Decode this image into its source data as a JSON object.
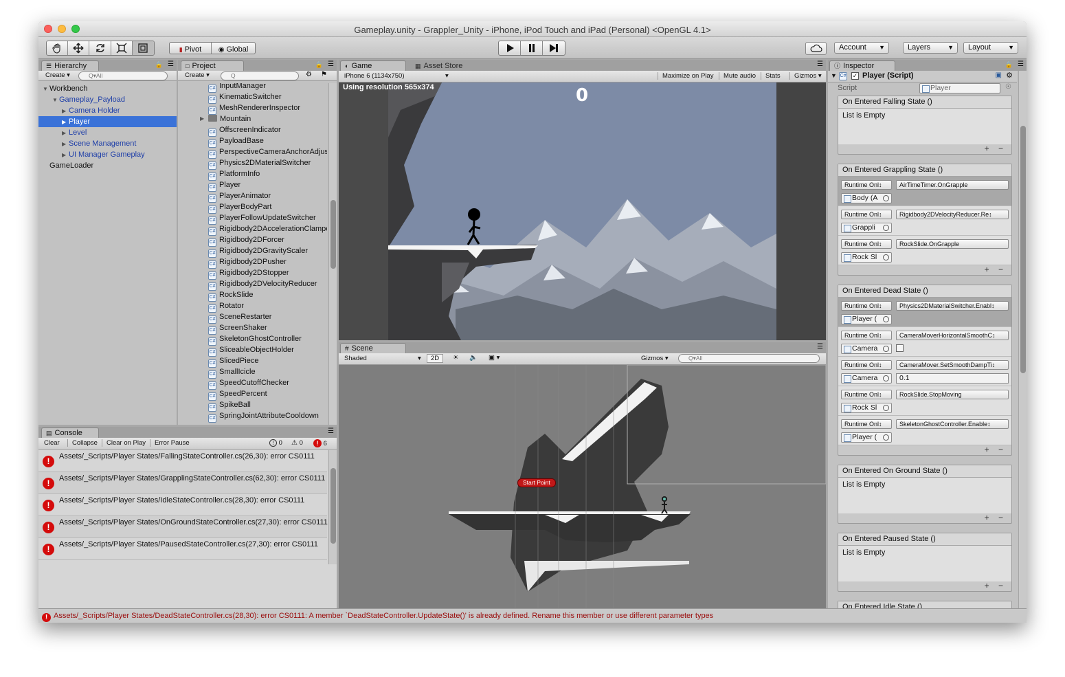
{
  "window": {
    "title": "Gameplay.unity - Grappler_Unity - iPhone, iPod Touch and iPad (Personal) <OpenGL 4.1>"
  },
  "toolbar": {
    "tools": [
      "hand-icon",
      "move-icon",
      "rotate-icon",
      "scale-icon",
      "rect-icon"
    ],
    "pivot_label": "Pivot",
    "global_label": "Global",
    "account_label": "Account",
    "layers_label": "Layers",
    "layout_label": "Layout"
  },
  "hierarchy": {
    "tab": "Hierarchy",
    "create_label": "Create",
    "search_placeholder": "Q▾All",
    "items": [
      {
        "label": "Workbench",
        "indent": 0,
        "expanded": true,
        "blue": false
      },
      {
        "label": "Gameplay_Payload",
        "indent": 1,
        "expanded": true,
        "blue": true
      },
      {
        "label": "Camera Holder",
        "indent": 2,
        "expanded": false,
        "blue": true
      },
      {
        "label": "Player",
        "indent": 2,
        "expanded": false,
        "blue": true,
        "selected": true
      },
      {
        "label": "Level",
        "indent": 2,
        "expanded": false,
        "blue": true
      },
      {
        "label": "Scene Management",
        "indent": 2,
        "expanded": false,
        "blue": true
      },
      {
        "label": "UI Manager Gameplay",
        "indent": 2,
        "expanded": false,
        "blue": true
      },
      {
        "label": "GameLoader",
        "indent": 0,
        "expanded": null,
        "blue": false
      }
    ]
  },
  "project": {
    "tab": "Project",
    "create_label": "Create",
    "search_placeholder": "Q",
    "items": [
      {
        "label": "InputManager",
        "type": "script"
      },
      {
        "label": "KinematicSwitcher",
        "type": "script"
      },
      {
        "label": "MeshRendererInspector",
        "type": "script"
      },
      {
        "label": "Mountain",
        "type": "folder"
      },
      {
        "label": "OffscreenIndicator",
        "type": "script"
      },
      {
        "label": "PayloadBase",
        "type": "script"
      },
      {
        "label": "PerspectiveCameraAnchorAdjuster",
        "type": "script"
      },
      {
        "label": "Physics2DMaterialSwitcher",
        "type": "script"
      },
      {
        "label": "PlatformInfo",
        "type": "script"
      },
      {
        "label": "Player",
        "type": "script"
      },
      {
        "label": "PlayerAnimator",
        "type": "script"
      },
      {
        "label": "PlayerBodyPart",
        "type": "script"
      },
      {
        "label": "PlayerFollowUpdateSwitcher",
        "type": "script"
      },
      {
        "label": "Rigidbody2DAccelerationClamper",
        "type": "script"
      },
      {
        "label": "Rigidbody2DForcer",
        "type": "script"
      },
      {
        "label": "Rigidbody2DGravityScaler",
        "type": "script"
      },
      {
        "label": "Rigidbody2DPusher",
        "type": "script"
      },
      {
        "label": "Rigidbody2DStopper",
        "type": "script"
      },
      {
        "label": "Rigidbody2DVelocityReducer",
        "type": "script"
      },
      {
        "label": "RockSlide",
        "type": "script"
      },
      {
        "label": "Rotator",
        "type": "script"
      },
      {
        "label": "SceneRestarter",
        "type": "script"
      },
      {
        "label": "ScreenShaker",
        "type": "script"
      },
      {
        "label": "SkeletonGhostController",
        "type": "script"
      },
      {
        "label": "SliceableObjectHolder",
        "type": "script"
      },
      {
        "label": "SlicedPiece",
        "type": "script"
      },
      {
        "label": "SmallIcicle",
        "type": "script"
      },
      {
        "label": "SpeedCutoffChecker",
        "type": "script"
      },
      {
        "label": "SpeedPercent",
        "type": "script"
      },
      {
        "label": "SpikeBall",
        "type": "script"
      },
      {
        "label": "SpringJointAttributeCooldown",
        "type": "script"
      }
    ]
  },
  "game": {
    "tab": "Game",
    "asset_store_tab": "Asset Store",
    "resolution_dropdown": "iPhone 6 (1134x750)",
    "maximize_label": "Maximize on Play",
    "mute_label": "Mute audio",
    "stats_label": "Stats",
    "gizmos_label": "Gizmos",
    "resolution_note": "Using resolution 565x374",
    "score": "0"
  },
  "scene": {
    "tab": "Scene",
    "shading": "Shaded",
    "mode_2d": "2D",
    "gizmos_label": "Gizmos",
    "search_placeholder": "Q▾All",
    "start_point_label": "Start Point"
  },
  "console": {
    "tab": "Console",
    "clear_label": "Clear",
    "collapse_label": "Collapse",
    "clear_on_play_label": "Clear on Play",
    "error_pause_label": "Error Pause",
    "info_count": "0",
    "warn_count": "0",
    "error_count": "6",
    "entries": [
      "Assets/_Scripts/Player States/FallingStateController.cs(26,30): error CS0111",
      "Assets/_Scripts/Player States/GrapplingStateController.cs(62,30): error CS0111",
      "Assets/_Scripts/Player States/IdleStateController.cs(28,30): error CS0111",
      "Assets/_Scripts/Player States/OnGroundStateController.cs(27,30): error CS0111",
      "Assets/_Scripts/Player States/PausedStateController.cs(27,30): error CS0111"
    ]
  },
  "status": {
    "message": "Assets/_Scripts/Player States/DeadStateController.cs(28,30): error CS0111: A member `DeadStateController.UpdateState()' is already defined. Rename this member or use different parameter types"
  },
  "inspector": {
    "tab": "Inspector",
    "component_title": "Player (Script)",
    "script_label": "Script",
    "script_value": "Player",
    "empty_text": "List is Empty",
    "events": [
      {
        "title": "On Entered Falling State ()",
        "rows": []
      },
      {
        "title": "On Entered Grappling State ()",
        "rows": [
          {
            "runtime": "Runtime Onl↕",
            "target": "Body (A",
            "method": "AirTimeTimer.OnGrapple",
            "value": null,
            "highlight": true
          },
          {
            "runtime": "Runtime Onl↕",
            "target": "Grappli",
            "method": "Rigidbody2DVelocityReducer.Re↕",
            "value": null,
            "highlight": false
          },
          {
            "runtime": "Runtime Onl↕",
            "target": "Rock Sl",
            "method": "RockSlide.OnGrapple",
            "value": null,
            "highlight": false
          }
        ]
      },
      {
        "title": "On Entered Dead State ()",
        "rows": [
          {
            "runtime": "Runtime Onl↕",
            "target": "Player (",
            "method": "Physics2DMaterialSwitcher.Enabl↕",
            "value": null,
            "highlight": true
          },
          {
            "runtime": "Runtime Onl↕",
            "target": "Camera",
            "method": "CameraMoverHorizontalSmoothC↕",
            "value": "checkbox",
            "highlight": false
          },
          {
            "runtime": "Runtime Onl↕",
            "target": "Camera",
            "method": "CameraMover.SetSmoothDampTi↕",
            "value": "0.1",
            "highlight": false
          },
          {
            "runtime": "Runtime Onl↕",
            "target": "Rock Sl",
            "method": "RockSlide.StopMoving",
            "value": null,
            "highlight": false
          },
          {
            "runtime": "Runtime Onl↕",
            "target": "Player (",
            "method": "SkeletonGhostController.Enable↕",
            "value": null,
            "highlight": false
          }
        ]
      },
      {
        "title": "On Entered On Ground State ()",
        "rows": []
      },
      {
        "title": "On Entered Paused State ()",
        "rows": []
      },
      {
        "title": "On Entered Idle State ()",
        "rows": []
      }
    ]
  },
  "colors": {
    "selection": "#3a72d8",
    "error_red": "#d40b0b",
    "game_sky": "#7c8aa3",
    "scene_bg": "#7e7e7e",
    "hier_blue": "#1f3fa8"
  }
}
